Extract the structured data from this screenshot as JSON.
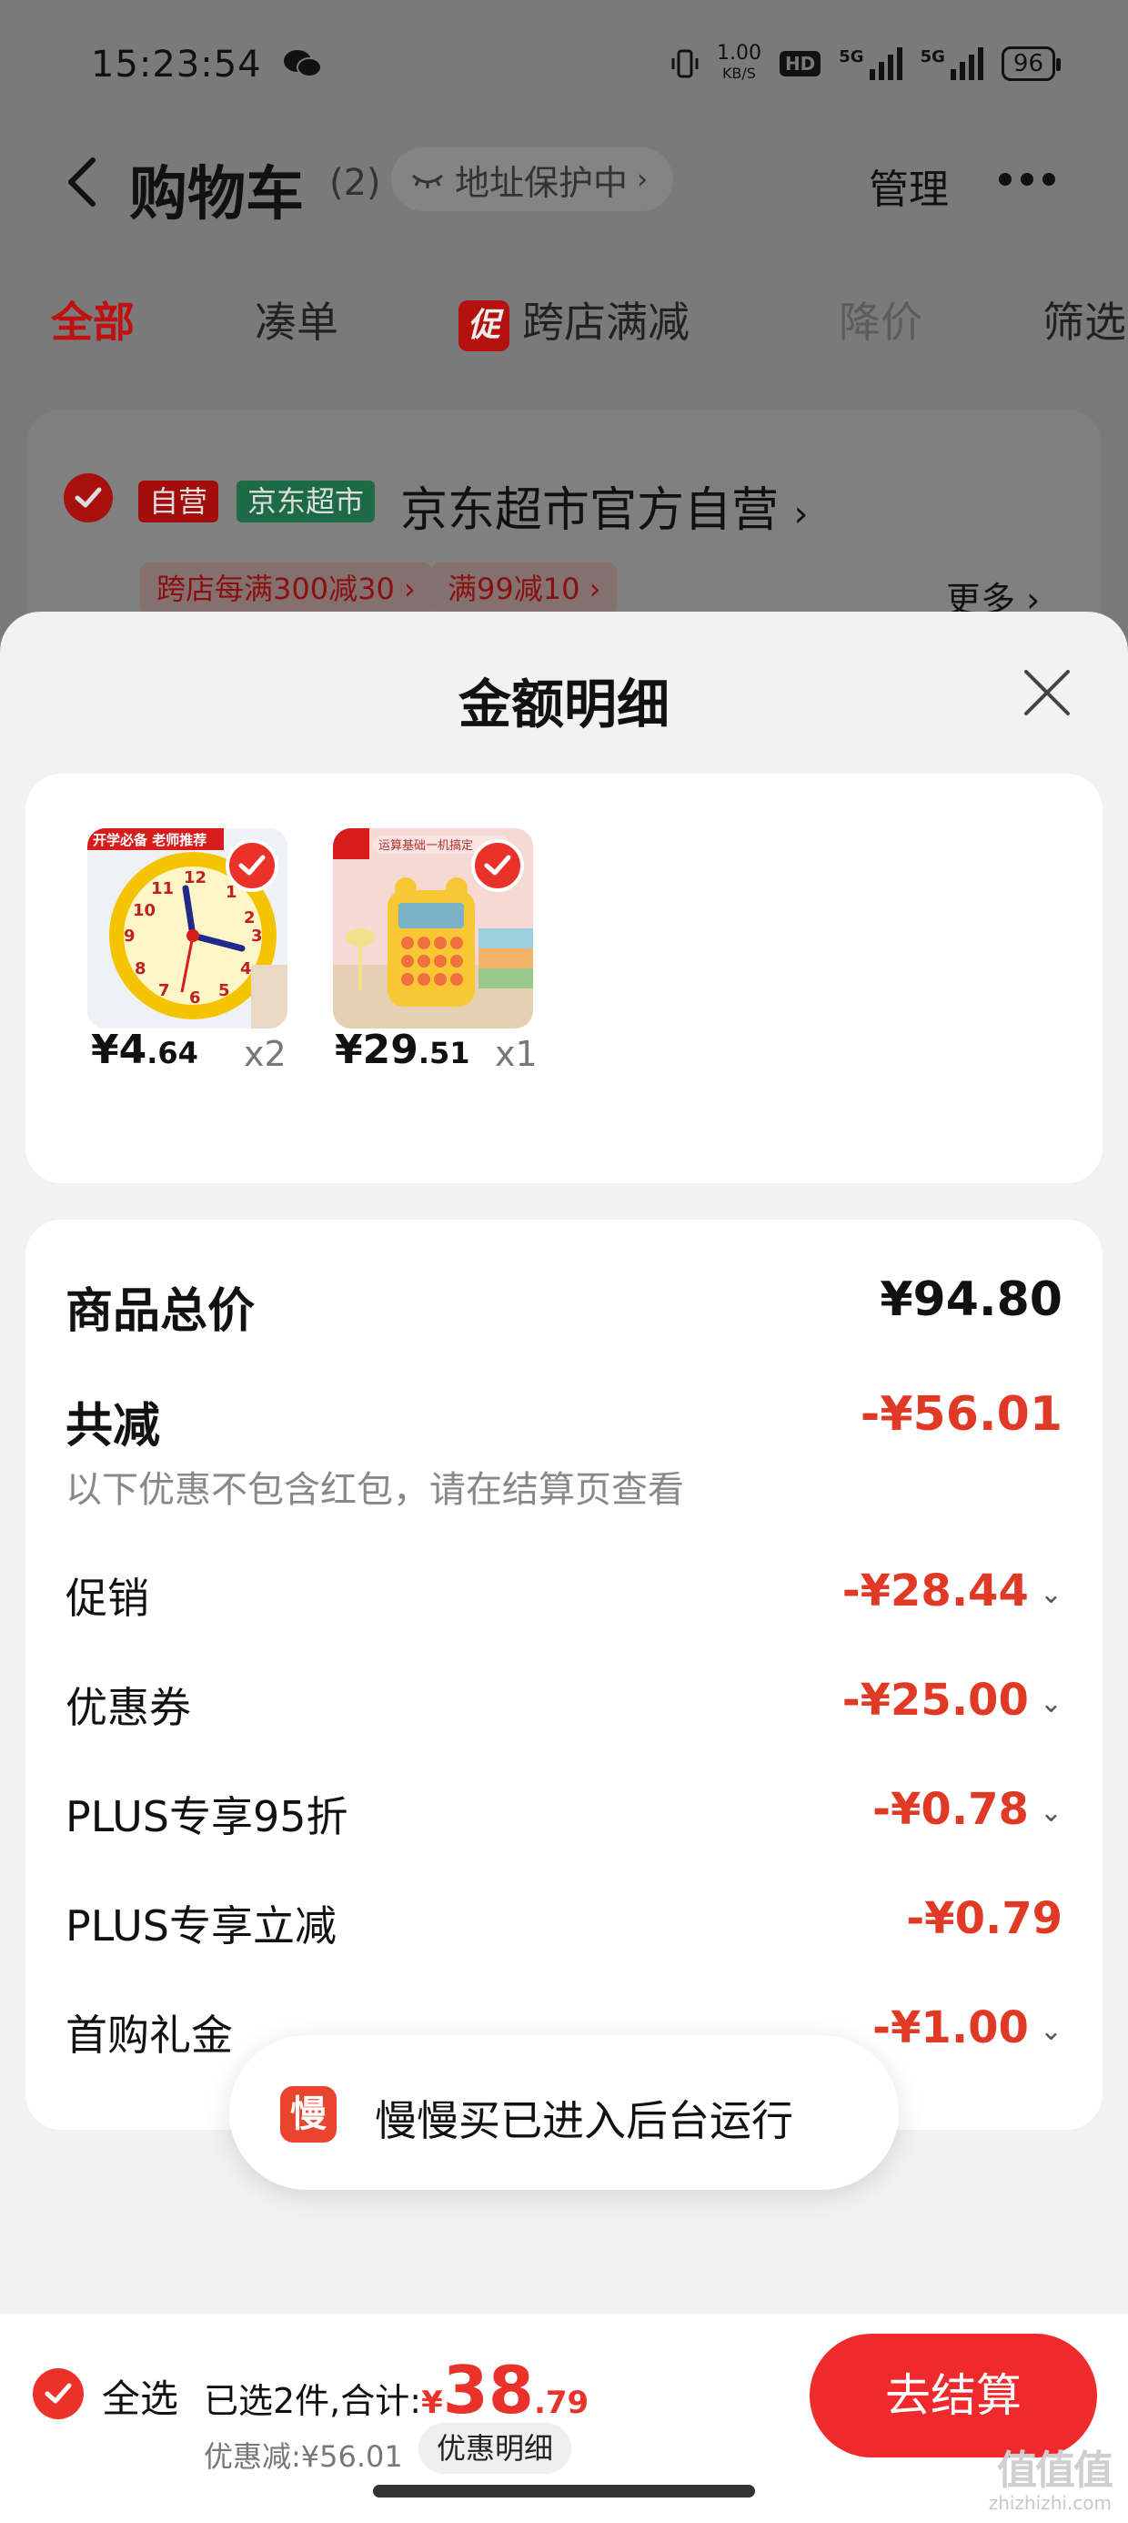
{
  "status_bar": {
    "time": "15:23:54",
    "net_speed_value": "1.00",
    "net_speed_unit": "KB/S",
    "hd_label": "HD",
    "sig1_label": "5G",
    "sig2_label": "5G",
    "battery": "96"
  },
  "nav": {
    "title": "购物车",
    "count": "(2)",
    "address_protect": "地址保护中",
    "manage": "管理"
  },
  "tabs": [
    {
      "label": "全部"
    },
    {
      "label": "凑单"
    },
    {
      "label": "跨店满减",
      "badge": "促"
    },
    {
      "label": "降价"
    },
    {
      "label": "筛选"
    }
  ],
  "shop": {
    "tag_self": "自营",
    "tag_super": "京东超市",
    "name": "京东超市官方自营",
    "promos": [
      "跨店每满300减30",
      "满99减10"
    ],
    "more": "更多"
  },
  "sheet": {
    "title": "金额明细",
    "goods": [
      {
        "thumb_tag": "开学必备 老师推荐",
        "price_int": "¥4",
        "price_dec": ".64",
        "qty": "x2"
      },
      {
        "thumb_tag": "运算基础一机搞定",
        "price_int": "¥29",
        "price_dec": ".51",
        "qty": "x1"
      }
    ],
    "total_label": "商品总价",
    "total_value": "¥94.80",
    "reduce_label": "共减",
    "reduce_value": "-¥56.01",
    "reduce_note": "以下优惠不包含红包，请在结算页查看",
    "items": [
      {
        "label": "促销",
        "value": "-¥28.44",
        "expandable": true
      },
      {
        "label": "优惠券",
        "value": "-¥25.00",
        "expandable": true
      },
      {
        "label": "PLUS专享95折",
        "value": "-¥0.78",
        "expandable": true
      },
      {
        "label": "PLUS专享立减",
        "value": "-¥0.79",
        "expandable": false
      },
      {
        "label": "首购礼金",
        "value": "-¥1.00",
        "expandable": true
      }
    ]
  },
  "toast": {
    "icon_char": "慢",
    "text": "慢慢买已进入后台运行"
  },
  "bottom": {
    "select_all": "全选",
    "summary_prefix": "已选2件,合计:",
    "total_symbol": "¥",
    "total_int": "38",
    "total_dec": ".79",
    "discount": "优惠减:¥56.01",
    "discount_detail": "优惠明细",
    "checkout": "去结算"
  },
  "watermark": {
    "big": "值值值",
    "small": "zhizhizhi.com"
  },
  "colors": {
    "accent_red": "#e8322a",
    "discount_red": "#e03a26",
    "jd_green": "#1c6b46"
  }
}
